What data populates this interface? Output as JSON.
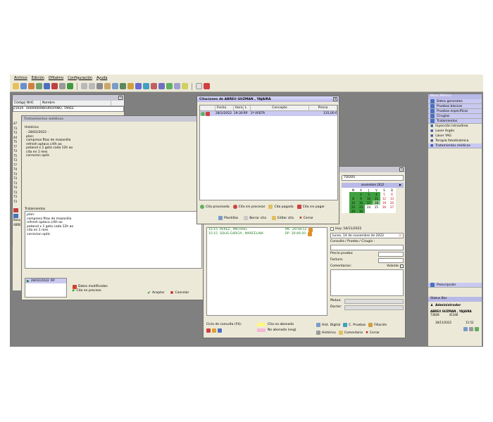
{
  "menu": [
    "Archivo",
    "Edición",
    "Ofitalmo",
    "Configuración",
    "Ayuda"
  ],
  "patient_list": {
    "headers": [
      "Código",
      "NHC",
      "Nombre"
    ],
    "first_row": {
      "code": "21620",
      "nhc": "000000000",
      "name": "- OUROFANO, TAREE"
    },
    "codes": [
      "47",
      "73",
      "73",
      "44",
      "75",
      "77",
      "73",
      "75",
      "73",
      "77",
      "74",
      "73",
      "73",
      "73",
      "74",
      "73",
      "73",
      "73",
      "74",
      "74"
    ],
    "bottom_labels": [
      "Búsq",
      "ABRE"
    ]
  },
  "history_window": {
    "title": "Tratamientos médicos",
    "historico_label": "Histórico",
    "historico_text": [
      "- 28/02/2022 -",
      "plan:",
      "compresa fitas de mazanilla",
      "refresh optaco c/4h ao",
      "patanol x 1 gota cada 12h ao",
      "cita en 1 mes",
      "correcion optic"
    ],
    "tratamientos_label": "Tratamientos",
    "tratamientos_text": [
      "plan:",
      "compresa fitas de mazanilla",
      "refresh optaco c/4h ao",
      "patanol x 1 gota cada 12h ao",
      "cita en 1 mes",
      "correcion optic"
    ],
    "entry": "28/02/2022",
    "entry_tag": "RP",
    "legend_modified": "Datos modificados",
    "legend_process": "Cita en proceso",
    "accept": "Aceptar",
    "cancel": "Cancelar"
  },
  "citas_window": {
    "title": "Citaciones de ABREU GUZMAN , YAJAIRA",
    "headers": [
      "Fecha",
      "Hora",
      "L",
      "Concepto",
      "Precio"
    ],
    "row": {
      "fecha": "28/2/2022",
      "hora": "19:30",
      "l": "RP",
      "concepto": "1ª VISITA",
      "precio": "135,00 €"
    },
    "legend": [
      "Cita procesada",
      "Cita sin procesar",
      "Cita pagada",
      "Cita sin pagar"
    ],
    "buttons": [
      "Plantillas",
      "Borrar cita",
      "Editar cita",
      "Cerrar"
    ]
  },
  "agenda": {
    "filter": "TODOS",
    "month": "noviembre 2022",
    "weekdays": [
      "M",
      "X",
      "J",
      "V",
      "S",
      "D"
    ],
    "weeks": [
      [
        "",
        "2",
        "3",
        "4",
        "5",
        "6"
      ],
      [
        "8",
        "9",
        "10",
        "11",
        "12",
        "13"
      ],
      [
        "15",
        "16",
        "17",
        "18",
        "19",
        "20"
      ],
      [
        "22",
        "23",
        "24",
        "25",
        "26",
        "27"
      ],
      [
        "29",
        "30",
        "",
        "",
        "",
        ""
      ]
    ],
    "rows": [
      {
        "time": "15:15",
        "name": "PEREZ , MICHAEL",
        "tag": "MC",
        "code": "20:58:12"
      },
      {
        "time": "15:15",
        "name": "SOLIS GARCIA , MARCELINA",
        "tag": "RP",
        "code": "20:49:20"
      }
    ],
    "hoy": "Hoy: 18/11/2022",
    "date_full": "lunes, 14 de noviembre de 2022",
    "consulta": "Consulta / Prueba / Cirugía :",
    "precio_prueba": "Precio prueba:",
    "factura": "Factura:",
    "comentarios": "Comentarios:",
    "volante": "Volante",
    "mutua": "Mutua:",
    "doctor": "Doctor:",
    "ciclo": "Ciclo de consulta (F4):",
    "no_abonada": "Cita no abonada",
    "no_abonada_neg": "No abonada (neg)",
    "btn_hist_digital": "Hist. Digital",
    "btn_pruebas": "C. Pruebas",
    "btn_filiacion": "Filiación",
    "btn_historico": "Histórico",
    "btn_comentario": "Comentario",
    "btn_cerrar": "Cerrar"
  },
  "sidebar": {
    "header": "Menú Médico",
    "items": [
      "Datos generales",
      "Pruebas básicas",
      "Pruebas específicas",
      "Cirugías",
      "Tratamientos"
    ],
    "subitems": [
      "Inyección intravítrea",
      "Laser Argón",
      "Láser YAG",
      "Terapia fotodinámica",
      "Tratamientos médicos"
    ],
    "prescripcion": "Prescripción"
  },
  "status": {
    "header": "Status Bar",
    "role": "Administrador",
    "patient": "ABREU GUZMAN , YAJAIRA",
    "code1": "73828",
    "code2": "41346",
    "date": "18/11/2022",
    "time": "11:52"
  }
}
